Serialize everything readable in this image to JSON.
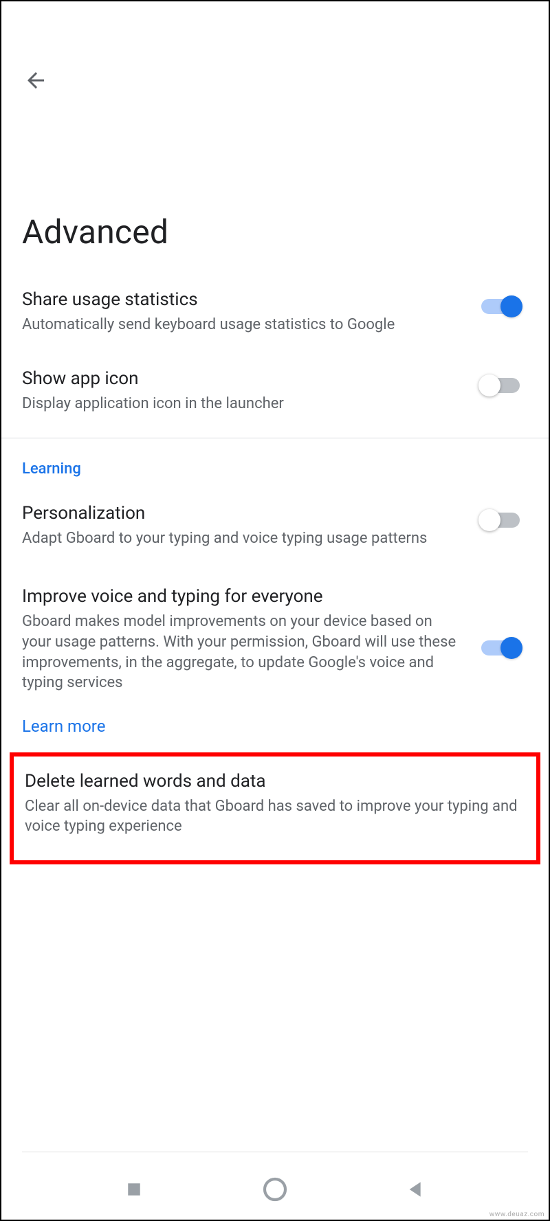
{
  "page": {
    "title": "Advanced"
  },
  "settings": [
    {
      "id": "share-usage",
      "title": "Share usage statistics",
      "desc": "Automatically send keyboard usage statistics to Google",
      "toggle": "on"
    },
    {
      "id": "show-app-icon",
      "title": "Show app icon",
      "desc": "Display application icon in the launcher",
      "toggle": "off"
    }
  ],
  "section": {
    "label": "Learning"
  },
  "learning_settings": [
    {
      "id": "personalization",
      "title": "Personalization",
      "desc": "Adapt Gboard to your typing and voice typing usage patterns",
      "toggle": "off"
    },
    {
      "id": "improve-voice-typing",
      "title": "Improve voice and typing for everyone",
      "desc": "Gboard makes model improvements on your device based on your usage patterns. With your permission, Gboard will use these improvements, in the aggregate, to update Google's voice and typing services",
      "toggle": "on"
    }
  ],
  "learn_more": "Learn more",
  "highlighted": {
    "title": "Delete learned words and data",
    "desc": "Clear all on-device data that Gboard has saved to improve your typing and voice typing experience"
  },
  "watermark": "www.deuaz.com"
}
